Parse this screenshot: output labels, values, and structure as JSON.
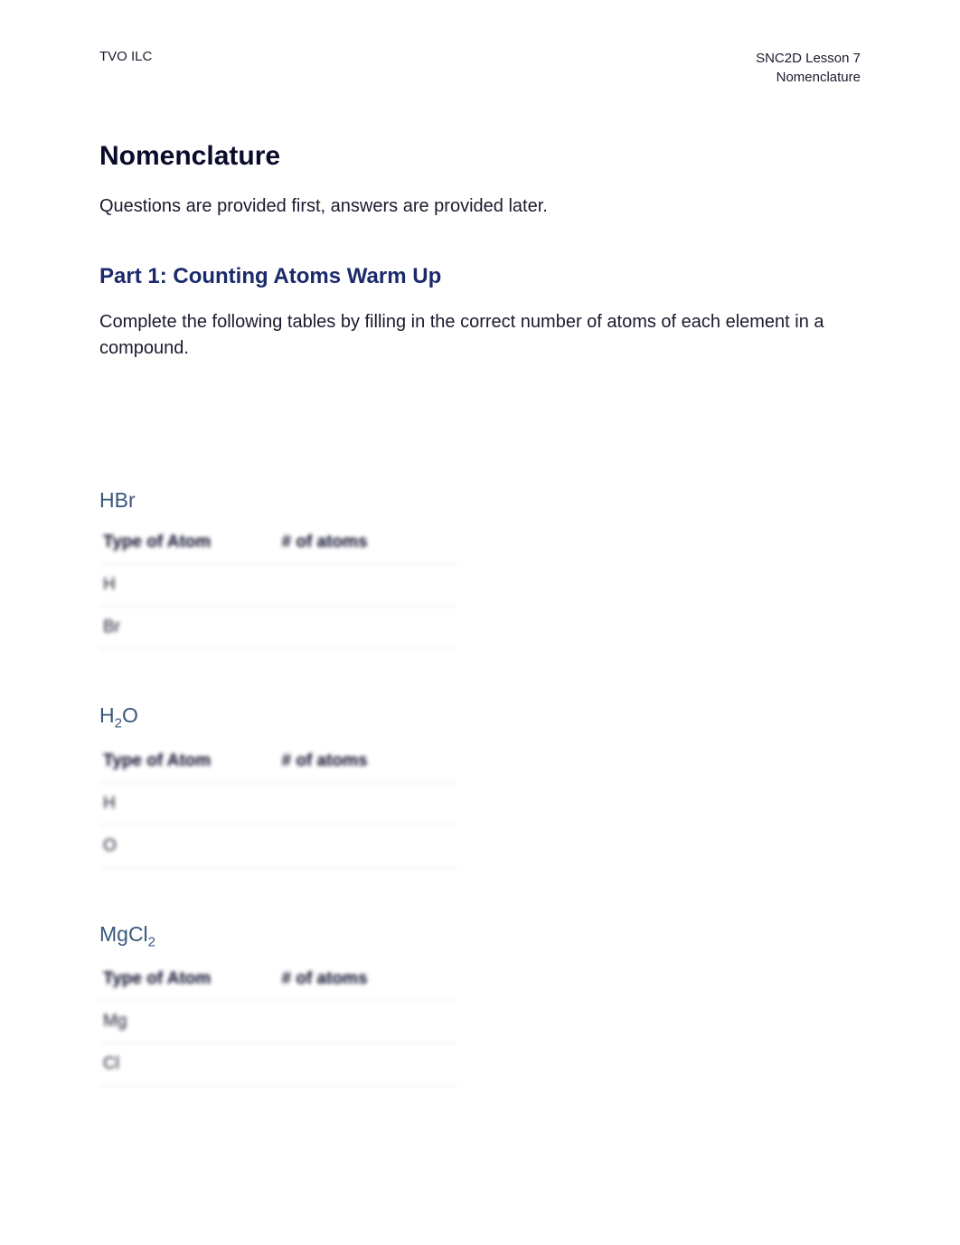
{
  "header": {
    "left": "TVO ILC",
    "right_line1": "SNC2D Lesson 7",
    "right_line2": "Nomenclature"
  },
  "page_title": "Nomenclature",
  "intro_text": "Questions are provided first, answers are provided later.",
  "section": {
    "title": "Part 1: Counting Atoms Warm Up",
    "instructions": "Complete the following tables by filling in the correct number of atoms of each element in a compound."
  },
  "table_headers": {
    "type": "Type of Atom",
    "num": "# of atoms"
  },
  "compounds": [
    {
      "name_html": "HBr",
      "rows": [
        {
          "type": "H",
          "num": ""
        },
        {
          "type": "Br",
          "num": ""
        }
      ]
    },
    {
      "name_html": "H<span class='sub'>2</span>O",
      "rows": [
        {
          "type": "H",
          "num": ""
        },
        {
          "type": "O",
          "num": ""
        }
      ]
    },
    {
      "name_html": "MgCl<span class='sub'>2</span>",
      "rows": [
        {
          "type": "Mg",
          "num": ""
        },
        {
          "type": "Cl",
          "num": ""
        }
      ]
    }
  ]
}
